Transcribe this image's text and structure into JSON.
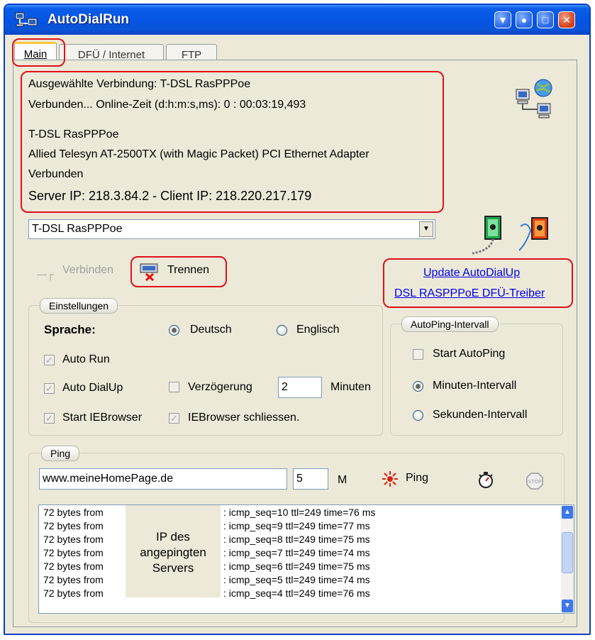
{
  "window": {
    "title": "AutoDialRun",
    "controls": [
      "minimize-to-tray",
      "help",
      "maximize",
      "close"
    ]
  },
  "tabs": [
    {
      "label": "Main",
      "active": true
    },
    {
      "label": "DFÜ / Internet",
      "active": false
    },
    {
      "label": "FTP",
      "active": false
    }
  ],
  "connection_info": {
    "selected": "Ausgewählte Verbindung: T-DSL RasPPPoe",
    "status_line": "Verbunden...  Online-Zeit (d:h:m:s,ms): 0 : 00:03:19,493",
    "name": "T-DSL RasPPPoe",
    "adapter": "Allied Telesyn AT-2500TX (with Magic Packet) PCI Ethernet Adapter",
    "state": "Verbunden",
    "ip_line": "Server IP: 218.3.84.2 - Client IP: 218.220.217.179"
  },
  "connection_select": {
    "value": "T-DSL RasPPPoe"
  },
  "buttons": {
    "connect": "Verbinden",
    "disconnect": "Trennen"
  },
  "links": {
    "update": "Update AutoDialUp",
    "driver": "DSL RASPPPoE DFÜ-Treiber"
  },
  "settings": {
    "title": "Einstellungen",
    "language_label": "Sprache:",
    "lang_de": "Deutsch",
    "lang_en": "Englisch",
    "selected_language": "Deutsch",
    "auto_run": {
      "label": "Auto Run",
      "checked": true
    },
    "auto_dialup": {
      "label": "Auto DialUp",
      "checked": true
    },
    "delay": {
      "label": "Verzögerung",
      "checked": false,
      "value": "2",
      "unit": "Minuten"
    },
    "start_ie": {
      "label": "Start IEBrowser",
      "checked": true
    },
    "close_ie": {
      "label": "IEBrowser schliessen.",
      "checked": true
    }
  },
  "autoping": {
    "title": "AutoPing-Intervall",
    "start": {
      "label": "Start AutoPing",
      "checked": false
    },
    "minutes": {
      "label": "Minuten-Intervall",
      "selected": true
    },
    "seconds": {
      "label": "Sekunden-Intervall",
      "selected": false
    }
  },
  "ping": {
    "title": "Ping",
    "host": "www.meineHomePage.de",
    "count": "5",
    "unit": "M",
    "ping_button": "Ping",
    "annotation": [
      "IP des",
      "angepingten",
      "Servers"
    ],
    "log": [
      {
        "left": "72 bytes from",
        "right": ": icmp_seq=10 ttl=249 time=76 ms"
      },
      {
        "left": "72 bytes from",
        "right": ": icmp_seq=9 ttl=249 time=77 ms"
      },
      {
        "left": "72 bytes from",
        "right": ": icmp_seq=8 ttl=249 time=75 ms"
      },
      {
        "left": "72 bytes from",
        "right": ": icmp_seq=7 ttl=249 time=74 ms"
      },
      {
        "left": "72 bytes from",
        "right": ": icmp_seq=6 ttl=249 time=75 ms"
      },
      {
        "left": "72 bytes from",
        "right": ": icmp_seq=5 ttl=249 time=74 ms"
      },
      {
        "left": "72 bytes from",
        "right": ": icmp_seq=4 ttl=249 time=76 ms"
      }
    ]
  },
  "colors": {
    "title_bar": "#0554e3",
    "window_face": "#ece9d8",
    "highlight": "#e0101a",
    "link": "#0000ee"
  }
}
